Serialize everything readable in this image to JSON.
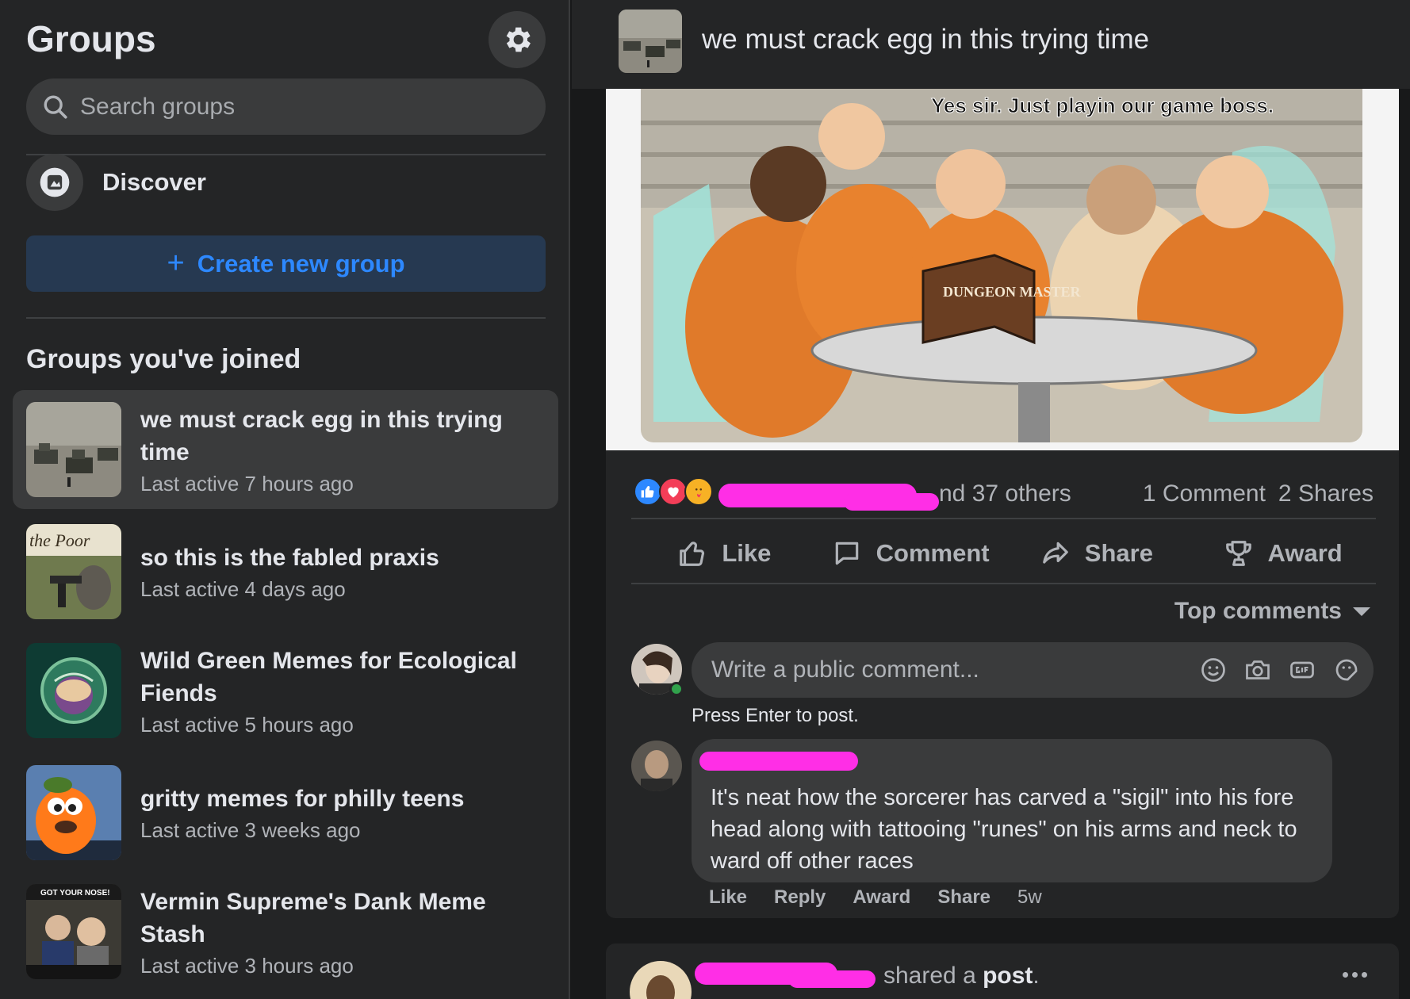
{
  "sidebar": {
    "title": "Groups",
    "search_placeholder": "Search groups",
    "discover_label": "Discover",
    "create_label": "Create new group",
    "joined_title": "Groups you've joined",
    "groups": [
      {
        "name": "we must crack egg in this trying time",
        "last_active": "Last active 7 hours ago",
        "thumb_text": ""
      },
      {
        "name": "so this is the fabled praxis",
        "last_active": "Last active 4 days ago",
        "thumb_text": "the Poor"
      },
      {
        "name": "Wild Green Memes for Ecological Fiends",
        "last_active": "Last active 5 hours ago",
        "thumb_text": ""
      },
      {
        "name": "gritty memes for philly teens",
        "last_active": "Last active 3 weeks ago",
        "thumb_text": ""
      },
      {
        "name": "Vermin Supreme's Dank Meme Stash",
        "last_active": "Last active 3 hours ago",
        "thumb_text": "GOT YOUR NOSE!"
      }
    ]
  },
  "header": {
    "title": "we must crack egg in this trying time"
  },
  "post": {
    "image_caption": "Yes sir. Just playin our game boss.",
    "image_book_text": "DUNGEON MASTER",
    "reactions": [
      "like-icon",
      "love-icon",
      "care-icon"
    ],
    "others_text": "nd 37 others",
    "comments_count": "1 Comment",
    "shares_count": "2 Shares",
    "actions": {
      "like": "Like",
      "comment": "Comment",
      "share": "Share",
      "award": "Award"
    },
    "sort_label": "Top comments",
    "comment_placeholder": "Write a public comment...",
    "press_enter": "Press Enter to post.",
    "comment": {
      "text": "It's neat how the sorcerer has carved a \"sigil\" into his fore head along with tattooing \"runes\" on his arms and neck to ward off other races",
      "actions": {
        "like": "Like",
        "reply": "Reply",
        "award": "Award",
        "share": "Share"
      },
      "time": "5w"
    }
  },
  "next_post": {
    "shared_text": "shared a",
    "post_word": "post",
    "period": "."
  },
  "colors": {
    "accent": "#2d88ff",
    "redaction": "#ff2ee6",
    "bg": "#18191a",
    "card": "#242526"
  }
}
